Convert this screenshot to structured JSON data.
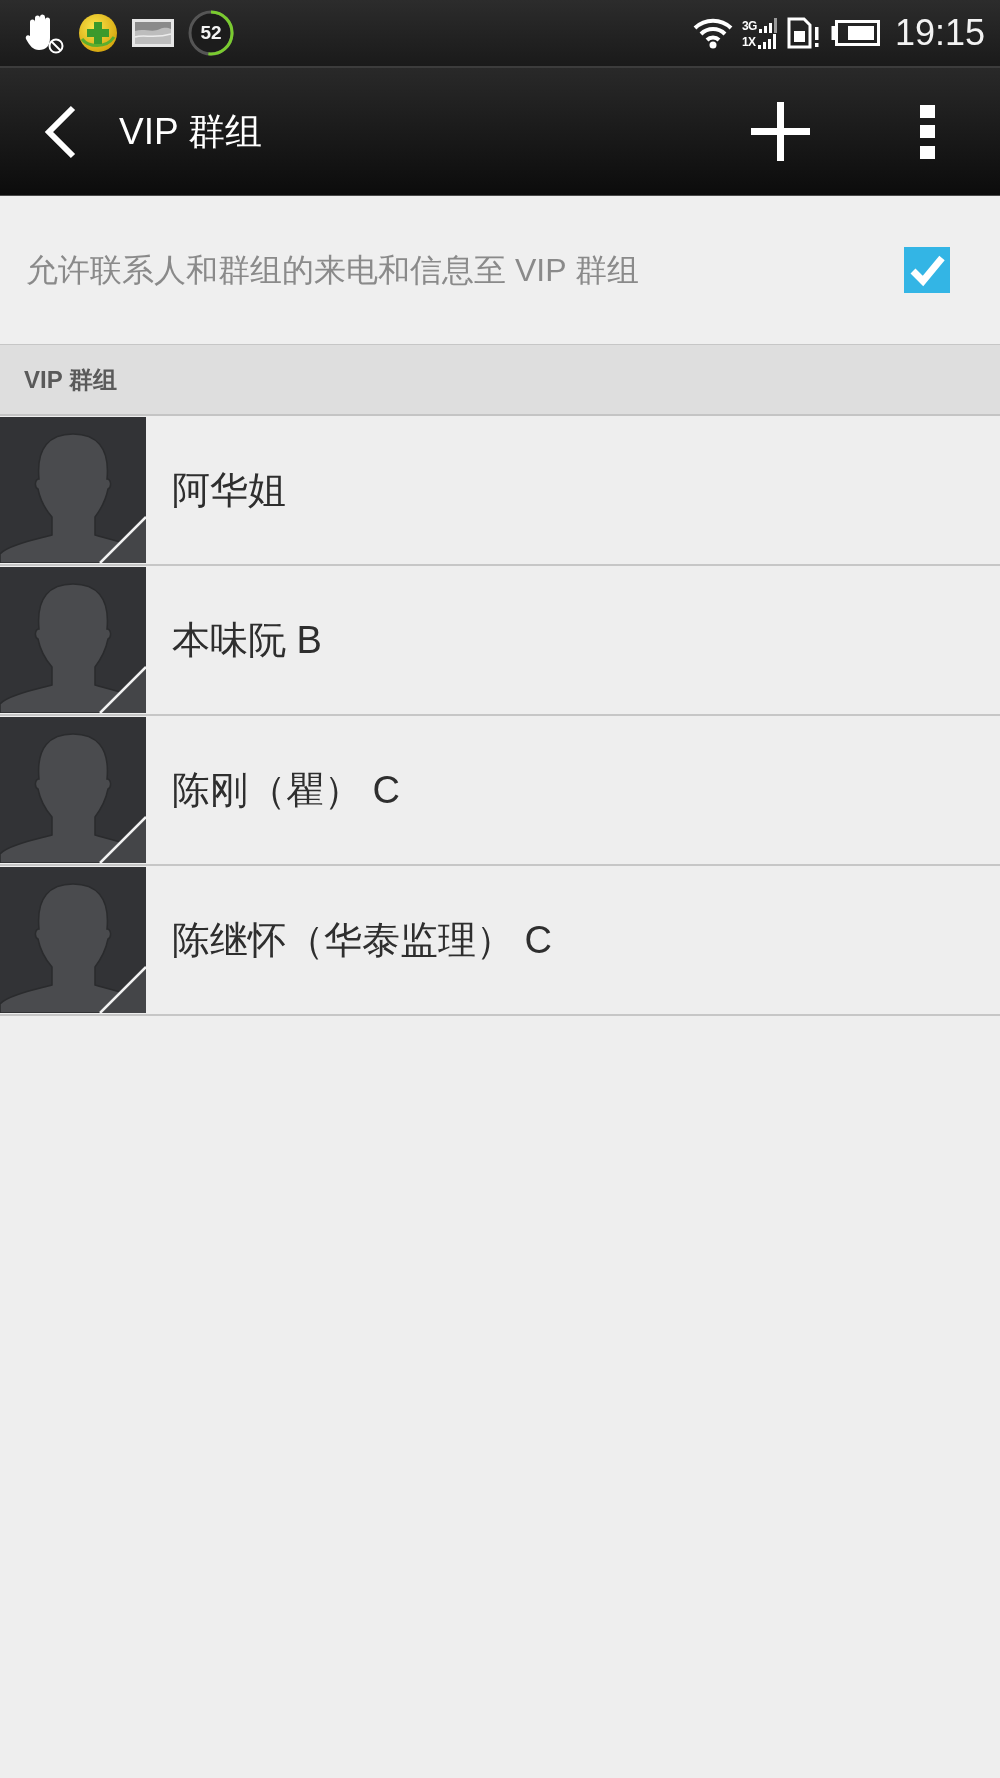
{
  "status_bar": {
    "ring": {
      "value": "52",
      "level": 0.52
    },
    "network": [
      {
        "label": "3G"
      },
      {
        "label": "1X"
      }
    ],
    "time": "19:15"
  },
  "action_bar": {
    "title": "VIP 群组"
  },
  "setting": {
    "label": "允许联系人和群组的来电和信息至 VIP 群组",
    "checked": true
  },
  "section": {
    "header": "VIP 群组",
    "contacts": [
      {
        "name": "阿华姐"
      },
      {
        "name": "本味阮 B"
      },
      {
        "name": "陈刚（瞿） C"
      },
      {
        "name": "陈继怀（华泰监理） C"
      }
    ]
  }
}
